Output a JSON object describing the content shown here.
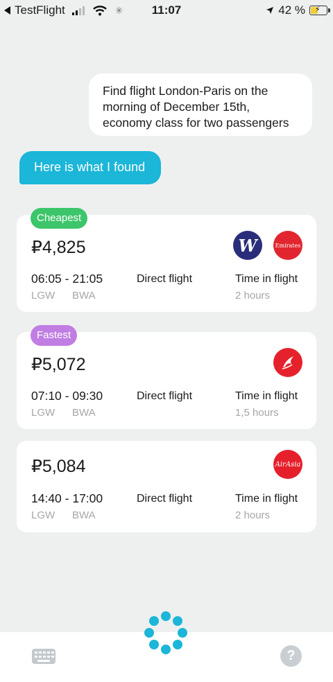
{
  "status_bar": {
    "back_app": "TestFlight",
    "time": "11:07",
    "battery": "42 %",
    "battery_level": 0.42
  },
  "chat": {
    "user_message": "Find flight London-Paris on the morning of December 15th, economy class for two passengers",
    "bot_message": "Here is what I found"
  },
  "flights": [
    {
      "badge": "Cheapest",
      "badge_color": "#3cc56a",
      "price": "₽4,825",
      "times": "06:05 - 21:05",
      "type": "Direct flight",
      "duration_label": "Time in flight",
      "duration": "2 hours",
      "from": "LGW",
      "to": "BWA",
      "airlines": [
        "wizz-air",
        "emirates"
      ],
      "airline_texts": {
        "wizz": "W",
        "emirates": "Emirates"
      }
    },
    {
      "badge": "Fastest",
      "badge_color": "#c07ee3",
      "price": "₽5,072",
      "times": "07:10 - 09:30",
      "type": "Direct flight",
      "duration_label": "Time in flight",
      "duration": "1,5 hours",
      "from": "LGW",
      "to": "BWA",
      "airlines": [
        "red-bird-airline"
      ]
    },
    {
      "price": "₽5,084",
      "times": "14:40 - 17:00",
      "type": "Direct flight",
      "duration_label": "Time in flight",
      "duration": "2 hours",
      "from": "LGW",
      "to": "BWA",
      "airlines": [
        "airasia"
      ],
      "airline_texts": {
        "airasia": "AirAsia"
      }
    }
  ],
  "bottom_bar": {
    "keyboard_icon": "keyboard-icon",
    "help_icon": "help-icon",
    "help_glyph": "?"
  },
  "colors": {
    "accent": "#1bb6d8",
    "background": "#eef0f0"
  }
}
